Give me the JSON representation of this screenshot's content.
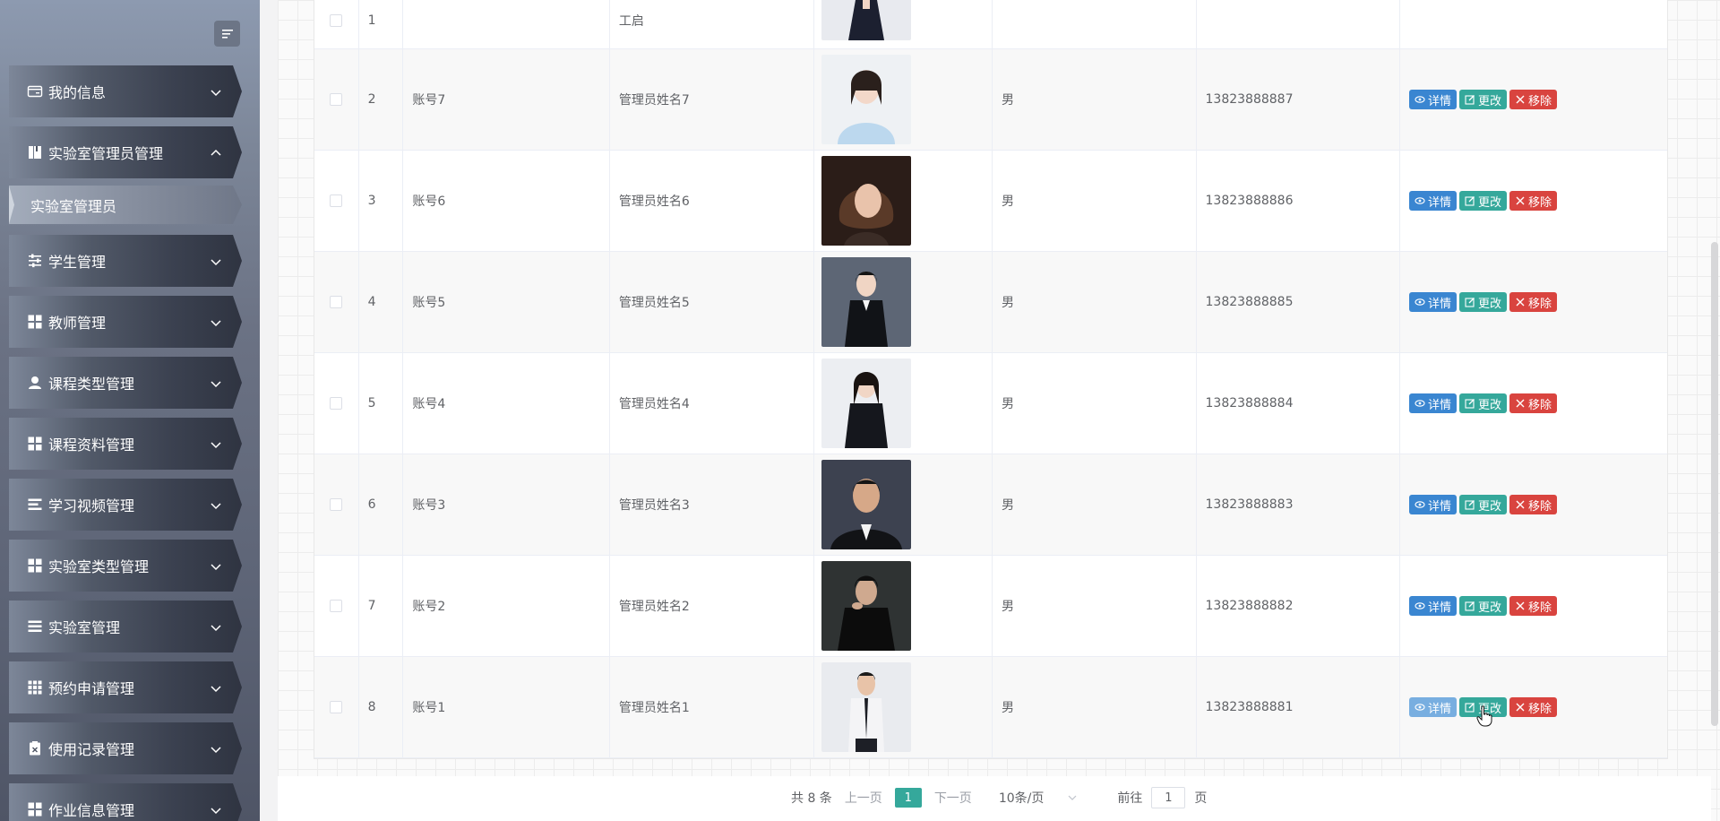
{
  "sidebar": {
    "menu": [
      {
        "label": "我的信息",
        "icon": "card-icon",
        "expanded": false
      },
      {
        "label": "实验室管理员管理",
        "icon": "book-icon",
        "expanded": true,
        "children": [
          {
            "label": "实验室管理员"
          }
        ]
      },
      {
        "label": "学生管理",
        "icon": "sliders-icon",
        "expanded": false
      },
      {
        "label": "教师管理",
        "icon": "grid-icon",
        "expanded": false
      },
      {
        "label": "课程类型管理",
        "icon": "user-icon",
        "expanded": false
      },
      {
        "label": "课程资料管理",
        "icon": "grid-icon",
        "expanded": false
      },
      {
        "label": "学习视频管理",
        "icon": "list-icon",
        "expanded": false
      },
      {
        "label": "实验室类型管理",
        "icon": "grid-icon",
        "expanded": false
      },
      {
        "label": "实验室管理",
        "icon": "list-icon",
        "expanded": false
      },
      {
        "label": "预约申请管理",
        "icon": "apps-icon",
        "expanded": false
      },
      {
        "label": "使用记录管理",
        "icon": "clipboard-icon",
        "expanded": false
      },
      {
        "label": "作业信息管理",
        "icon": "grid-icon",
        "expanded": false
      }
    ]
  },
  "table": {
    "rows": [
      {
        "index": "2",
        "account": "账号7",
        "name": "管理员姓名7",
        "sex": "男",
        "phone": "13823888887",
        "photo": "woman-light-blue-shirt"
      },
      {
        "index": "3",
        "account": "账号6",
        "name": "管理员姓名6",
        "sex": "男",
        "phone": "13823888886",
        "photo": "woman-short-hair"
      },
      {
        "index": "4",
        "account": "账号5",
        "name": "管理员姓名5",
        "sex": "男",
        "phone": "13823888885",
        "photo": "woman-black-suit"
      },
      {
        "index": "5",
        "account": "账号4",
        "name": "管理员姓名4",
        "sex": "男",
        "phone": "13823888884",
        "photo": "woman-black-suit-2"
      },
      {
        "index": "6",
        "account": "账号3",
        "name": "管理员姓名3",
        "sex": "男",
        "phone": "13823888883",
        "photo": "man-suit"
      },
      {
        "index": "7",
        "account": "账号2",
        "name": "管理员姓名2",
        "sex": "男",
        "phone": "13823888882",
        "photo": "man-black-sweater"
      },
      {
        "index": "8",
        "account": "账号1",
        "name": "管理员姓名1",
        "sex": "男",
        "phone": "13823888881",
        "photo": "man-white-shirt-tie"
      }
    ],
    "actions": {
      "detail": "详情",
      "edit": "更改",
      "delete": "移除"
    },
    "first_row_partial": {
      "index": "1",
      "name": "工启"
    }
  },
  "pagination": {
    "total": "共 8 条",
    "prev": "上一页",
    "current": "1",
    "next": "下一页",
    "page_size": "10条/页",
    "goto_label": "前往",
    "goto_value": "1",
    "page_unit": "页"
  },
  "colors": {
    "primary": "#35a89b",
    "detail_button": "#3a86d1",
    "edit_button": "#35a89b",
    "delete_button": "#d9443f"
  }
}
